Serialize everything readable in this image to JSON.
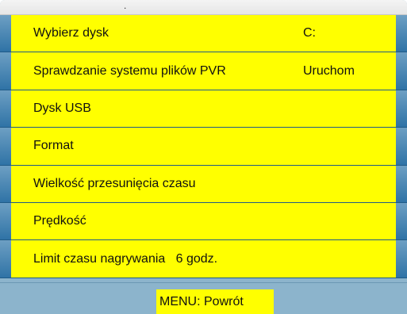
{
  "header": {
    "mark": "."
  },
  "menu": {
    "items": [
      {
        "label": "Wybierz dysk",
        "value": "C:"
      },
      {
        "label": "Sprawdzanie systemu plików PVR",
        "value": "Uruchom"
      },
      {
        "label": "Dysk USB",
        "value": ""
      },
      {
        "label": "Format",
        "value": ""
      },
      {
        "label": "Wielkość przesunięcia czasu",
        "value": ""
      },
      {
        "label": "Prędkość",
        "value": ""
      },
      {
        "label": "Limit czasu nagrywania   6 godz.",
        "value": ""
      }
    ]
  },
  "footer": {
    "back_label": "MENU: Powrót"
  },
  "colors": {
    "highlight": "#ffff00",
    "row_blue": "#2f73a6",
    "background": "#8cb4cc"
  }
}
